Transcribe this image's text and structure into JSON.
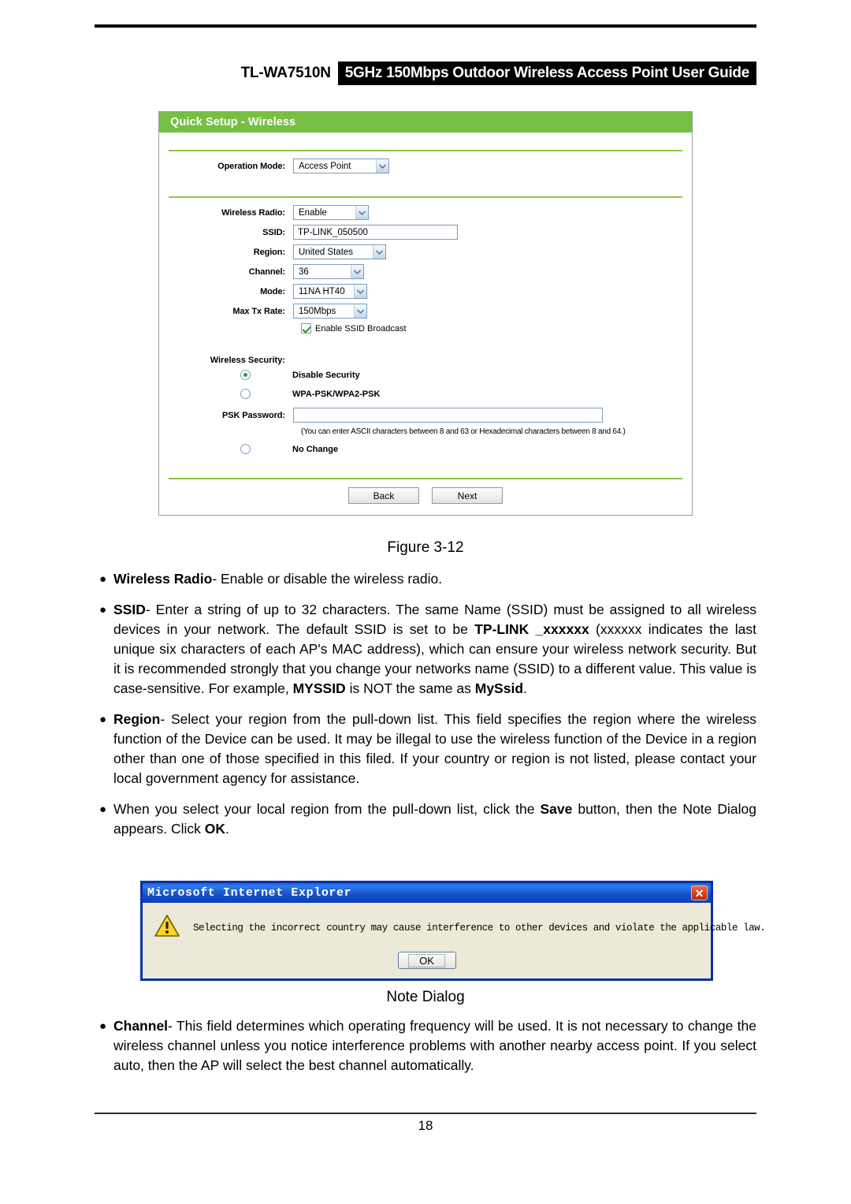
{
  "header": {
    "model": "TL-WA7510N",
    "title": "5GHz 150Mbps Outdoor Wireless Access Point User Guide"
  },
  "panel": {
    "title": "Quick Setup - Wireless",
    "operation_mode": {
      "label": "Operation Mode:",
      "value": "Access Point"
    },
    "wireless_radio": {
      "label": "Wireless Radio:",
      "value": "Enable"
    },
    "ssid": {
      "label": "SSID:",
      "value": "TP-LINK_050500"
    },
    "region": {
      "label": "Region:",
      "value": "United States"
    },
    "channel": {
      "label": "Channel:",
      "value": "36"
    },
    "mode": {
      "label": "Mode:",
      "value": "11NA HT40"
    },
    "max_tx_rate": {
      "label": "Max Tx Rate:",
      "value": "150Mbps"
    },
    "ssid_broadcast": {
      "label": "Enable SSID Broadcast",
      "checked": true
    },
    "wireless_security": {
      "label": "Wireless Security:"
    },
    "security_options": [
      {
        "label": "Disable Security",
        "selected": true
      },
      {
        "label": "WPA-PSK/WPA2-PSK",
        "selected": false
      },
      {
        "label": "No Change",
        "selected": false
      }
    ],
    "psk_password": {
      "label": "PSK Password:",
      "value": ""
    },
    "psk_hint": "(You can enter ASCII characters between 8 and 63 or Hexadecimal characters between 8 and 64.)",
    "buttons": {
      "back": "Back",
      "next": "Next"
    },
    "colors": {
      "header_green": "#76bf43",
      "separator_green": "#8cc63e"
    }
  },
  "captions": {
    "figure": "Figure 3-12",
    "note_dialog": "Note Dialog"
  },
  "bullets": {
    "wireless_radio": {
      "term": "Wireless Radio",
      "body": "- Enable or disable the wireless radio."
    },
    "ssid": {
      "p1": "- Enter a string of up to 32 characters. The same Name (SSID) must be assigned to all wireless devices in your network. The default SSID is set to be ",
      "term": "SSID",
      "bold1": "TP-LINK _xxxxxx",
      "p2": " (xxxxxx indicates the last unique six characters of each AP's MAC address), which can ensure your wireless network security. But it is recommended strongly that you change your networks name (SSID) to a different value. This value is case-sensitive. For example, ",
      "bold2": "MYSSID",
      "p3": " is NOT the same as ",
      "bold3": "MySsid",
      "p4": "."
    },
    "region": {
      "term": "Region",
      "body": "- Select your region from the pull-down list. This field specifies the region where the wireless function of the Device can be used. It may be illegal to use the wireless function of the Device in a region other than one of those specified in this filed. If your country or region is not listed, please contact your local government agency for assistance."
    },
    "save_note": {
      "p1": "When you select your local region from the pull-down list, click the ",
      "bold1": "Save",
      "p2": " button, then the Note Dialog appears. Click ",
      "bold2": "OK",
      "p3": "."
    },
    "channel": {
      "term": "Channel",
      "body": "- This field determines which operating frequency will be used. It is not necessary to change the wireless channel unless you notice interference problems with another nearby access point. If you select auto, then the AP will select the best channel automatically."
    }
  },
  "dialog": {
    "title": "Microsoft Internet Explorer",
    "close_label": "✕",
    "message": "Selecting the incorrect country may cause interference to other devices and violate the applicable law.",
    "ok_label": "OK"
  },
  "footer": {
    "page_number": "18"
  }
}
